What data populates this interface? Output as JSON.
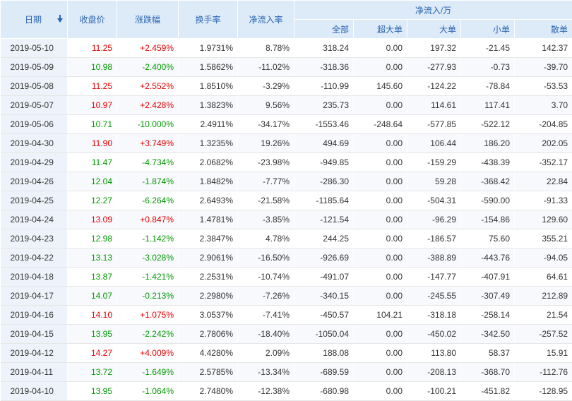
{
  "header": {
    "date": "日期",
    "close": "收盘价",
    "change": "涨跌幅",
    "turnover": "换手率",
    "net_inflow_rate": "净流入率",
    "net_flow_group": "净流入/万",
    "all": "全部",
    "super_large": "超大单",
    "large": "大单",
    "small": "小单",
    "retail": "散单"
  },
  "colors": {
    "up": "#e60000",
    "down": "#009900",
    "header_bg": "#ddeaf8",
    "header_text": "#2a65b2"
  },
  "rows": [
    {
      "date": "2019-05-10",
      "close": "11.25",
      "change": "+2.459%",
      "turnover": "1.9731%",
      "rate": "8.78%",
      "all": "318.24",
      "super": "0.00",
      "large": "197.32",
      "small": "-21.45",
      "retail": "142.37",
      "dir": "up"
    },
    {
      "date": "2019-05-09",
      "close": "10.98",
      "change": "-2.400%",
      "turnover": "1.5862%",
      "rate": "-11.02%",
      "all": "-318.36",
      "super": "0.00",
      "large": "-277.93",
      "small": "-0.73",
      "retail": "-39.70",
      "dir": "down"
    },
    {
      "date": "2019-05-08",
      "close": "11.25",
      "change": "+2.552%",
      "turnover": "1.8510%",
      "rate": "-3.29%",
      "all": "-110.99",
      "super": "145.60",
      "large": "-124.22",
      "small": "-78.84",
      "retail": "-53.53",
      "dir": "up"
    },
    {
      "date": "2019-05-07",
      "close": "10.97",
      "change": "+2.428%",
      "turnover": "1.3823%",
      "rate": "9.56%",
      "all": "235.73",
      "super": "0.00",
      "large": "114.61",
      "small": "117.41",
      "retail": "3.70",
      "dir": "up"
    },
    {
      "date": "2019-05-06",
      "close": "10.71",
      "change": "-10.000%",
      "turnover": "2.4911%",
      "rate": "-34.17%",
      "all": "-1553.46",
      "super": "-248.64",
      "large": "-577.85",
      "small": "-522.12",
      "retail": "-204.85",
      "dir": "down"
    },
    {
      "date": "2019-04-30",
      "close": "11.90",
      "change": "+3.749%",
      "turnover": "1.3235%",
      "rate": "19.26%",
      "all": "494.69",
      "super": "0.00",
      "large": "106.44",
      "small": "186.20",
      "retail": "202.05",
      "dir": "up"
    },
    {
      "date": "2019-04-29",
      "close": "11.47",
      "change": "-4.734%",
      "turnover": "2.0682%",
      "rate": "-23.98%",
      "all": "-949.85",
      "super": "0.00",
      "large": "-159.29",
      "small": "-438.39",
      "retail": "-352.17",
      "dir": "down"
    },
    {
      "date": "2019-04-26",
      "close": "12.04",
      "change": "-1.874%",
      "turnover": "1.8482%",
      "rate": "-7.77%",
      "all": "-286.30",
      "super": "0.00",
      "large": "59.28",
      "small": "-368.42",
      "retail": "22.84",
      "dir": "down"
    },
    {
      "date": "2019-04-25",
      "close": "12.27",
      "change": "-6.264%",
      "turnover": "2.6493%",
      "rate": "-21.58%",
      "all": "-1185.64",
      "super": "0.00",
      "large": "-504.31",
      "small": "-590.00",
      "retail": "-91.33",
      "dir": "down"
    },
    {
      "date": "2019-04-24",
      "close": "13.09",
      "change": "+0.847%",
      "turnover": "1.4781%",
      "rate": "-3.85%",
      "all": "-121.54",
      "super": "0.00",
      "large": "-96.29",
      "small": "-154.86",
      "retail": "129.60",
      "dir": "up"
    },
    {
      "date": "2019-04-23",
      "close": "12.98",
      "change": "-1.142%",
      "turnover": "2.3847%",
      "rate": "4.78%",
      "all": "244.25",
      "super": "0.00",
      "large": "-186.57",
      "small": "75.60",
      "retail": "355.21",
      "dir": "down"
    },
    {
      "date": "2019-04-22",
      "close": "13.13",
      "change": "-3.028%",
      "turnover": "2.9061%",
      "rate": "-16.50%",
      "all": "-926.69",
      "super": "0.00",
      "large": "-388.89",
      "small": "-443.76",
      "retail": "-94.05",
      "dir": "down"
    },
    {
      "date": "2019-04-18",
      "close": "13.87",
      "change": "-1.421%",
      "turnover": "2.2531%",
      "rate": "-10.74%",
      "all": "-491.07",
      "super": "0.00",
      "large": "-147.77",
      "small": "-407.91",
      "retail": "64.61",
      "dir": "down"
    },
    {
      "date": "2019-04-17",
      "close": "14.07",
      "change": "-0.213%",
      "turnover": "2.2980%",
      "rate": "-7.26%",
      "all": "-340.15",
      "super": "0.00",
      "large": "-245.55",
      "small": "-307.49",
      "retail": "212.89",
      "dir": "down"
    },
    {
      "date": "2019-04-16",
      "close": "14.10",
      "change": "+1.075%",
      "turnover": "3.0537%",
      "rate": "-7.41%",
      "all": "-450.57",
      "super": "104.21",
      "large": "-318.18",
      "small": "-258.14",
      "retail": "21.54",
      "dir": "up"
    },
    {
      "date": "2019-04-15",
      "close": "13.95",
      "change": "-2.242%",
      "turnover": "2.7806%",
      "rate": "-18.40%",
      "all": "-1050.04",
      "super": "0.00",
      "large": "-450.02",
      "small": "-342.50",
      "retail": "-257.52",
      "dir": "down"
    },
    {
      "date": "2019-04-12",
      "close": "14.27",
      "change": "+4.009%",
      "turnover": "4.4280%",
      "rate": "2.09%",
      "all": "188.08",
      "super": "0.00",
      "large": "113.80",
      "small": "58.37",
      "retail": "15.91",
      "dir": "up"
    },
    {
      "date": "2019-04-11",
      "close": "13.72",
      "change": "-1.649%",
      "turnover": "2.5785%",
      "rate": "-13.34%",
      "all": "-689.59",
      "super": "0.00",
      "large": "-208.13",
      "small": "-368.70",
      "retail": "-112.76",
      "dir": "down"
    },
    {
      "date": "2019-04-10",
      "close": "13.95",
      "change": "-1.064%",
      "turnover": "2.7480%",
      "rate": "-12.38%",
      "all": "-680.98",
      "super": "0.00",
      "large": "-100.21",
      "small": "-451.82",
      "retail": "-128.95",
      "dir": "down"
    }
  ]
}
